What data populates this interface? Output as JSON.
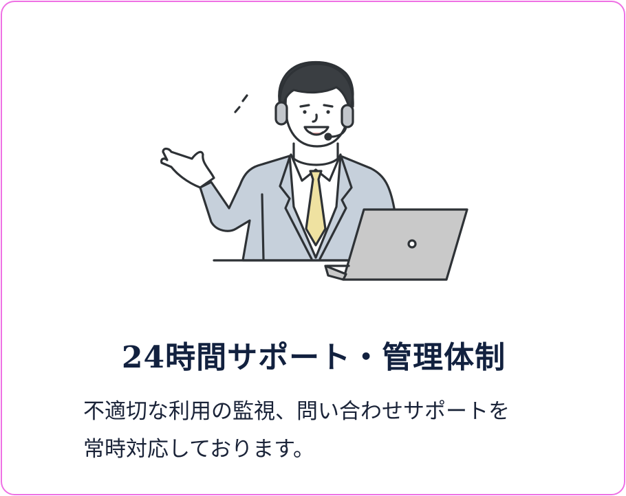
{
  "card": {
    "border_color": "#ee70e4",
    "illustration_icon": "support-operator-illustration",
    "title": "24時間サポート・管理体制",
    "description_lines": [
      "不適切な利用の監視、問い合わせサポートを",
      "常時対応しております。"
    ]
  }
}
